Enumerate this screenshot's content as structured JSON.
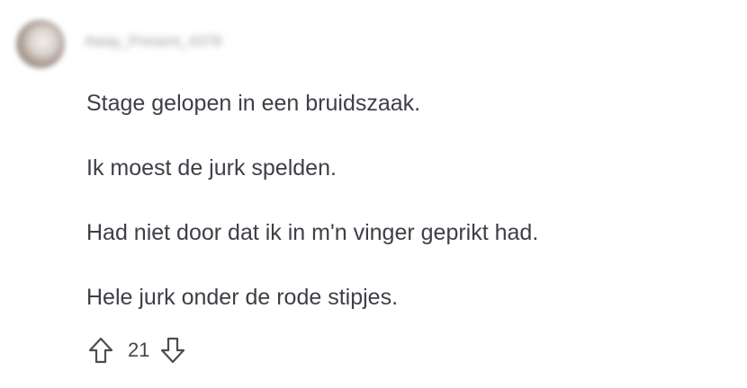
{
  "comment": {
    "username": "Away_Present_4378",
    "paragraphs": [
      "Stage gelopen in een bruidszaak.",
      "Ik moest de jurk spelden.",
      "Had niet door dat ik in m'n vinger geprikt had.",
      "Hele jurk onder de rode stipjes."
    ],
    "score": "21",
    "icons": {
      "upvote": "arrow-up-outline-icon",
      "downvote": "arrow-down-outline-icon"
    }
  },
  "colors": {
    "text": "#3d4046",
    "icon": "#4a4d53",
    "background": "#ffffff"
  }
}
